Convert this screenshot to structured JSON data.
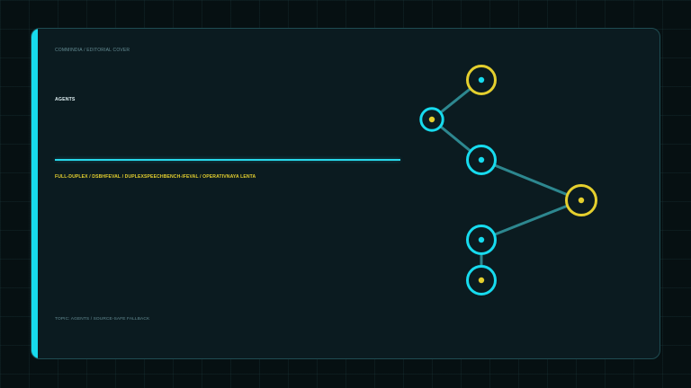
{
  "cover": {
    "kicker": "COMMINDIA / EDITORIAL COVER",
    "headline": "AGENTS",
    "tags": "FULL-DUPLEX / DSBHFEVAL / DUPLEXSPEECHBENCH-IFEVAL / OPERATIVNAYA LENTA",
    "footer": "TOPIC: AGENTS / SOURCE-SAFE FALLBACK"
  },
  "colors": {
    "background": "#061012",
    "card": "#0b1b20",
    "cyan": "#17dbee",
    "yellow": "#e4cf2e",
    "edge": "#2f8d95",
    "muted_text": "#658d94"
  },
  "graph": {
    "icon": "network-graph-icon",
    "nodes": [
      {
        "id": "top-yellow",
        "ring": "yellow",
        "dot": "cyan"
      },
      {
        "id": "upper-left",
        "ring": "cyan",
        "dot": "yellow"
      },
      {
        "id": "center-cyan",
        "ring": "cyan",
        "dot": "cyan"
      },
      {
        "id": "right-yellow",
        "ring": "yellow",
        "dot": "yellow"
      },
      {
        "id": "lower-cyan",
        "ring": "cyan",
        "dot": "cyan"
      },
      {
        "id": "bottom-cyan",
        "ring": "cyan",
        "dot": "yellow"
      }
    ],
    "edges": [
      [
        "upper-left",
        "top-yellow"
      ],
      [
        "upper-left",
        "center-cyan"
      ],
      [
        "center-cyan",
        "right-yellow"
      ],
      [
        "right-yellow",
        "lower-cyan"
      ],
      [
        "lower-cyan",
        "bottom-cyan"
      ]
    ]
  }
}
